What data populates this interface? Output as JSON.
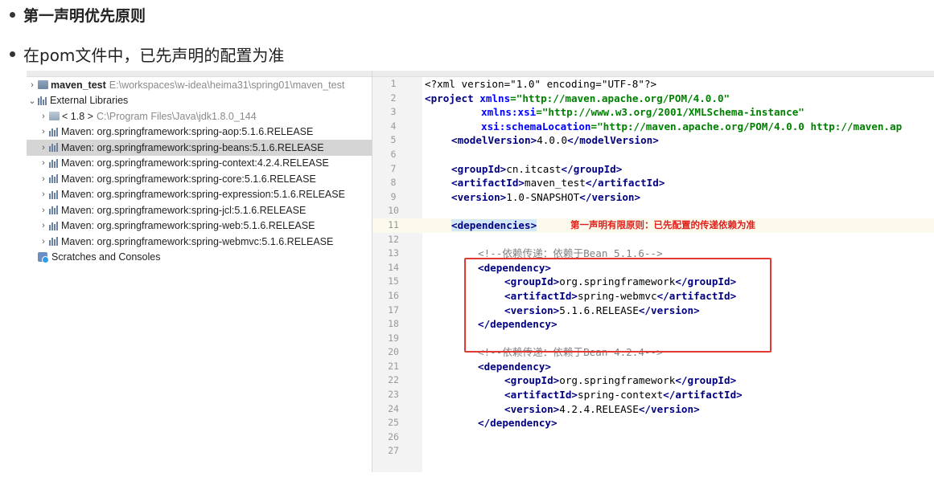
{
  "slide": {
    "bullet1": "第一声明优先原则",
    "bullet2": "在pom文件中，已先声明的配置为准"
  },
  "project_tree": {
    "root": {
      "name": "maven_test",
      "path": "E:\\workspaces\\w-idea\\heima31\\spring01\\maven_test"
    },
    "external_libraries": "External Libraries",
    "jdk": {
      "name": "< 1.8 >",
      "path": "C:\\Program Files\\Java\\jdk1.8.0_144"
    },
    "libraries": [
      "Maven: org.springframework:spring-aop:5.1.6.RELEASE",
      "Maven: org.springframework:spring-beans:5.1.6.RELEASE",
      "Maven: org.springframework:spring-context:4.2.4.RELEASE",
      "Maven: org.springframework:spring-core:5.1.6.RELEASE",
      "Maven: org.springframework:spring-expression:5.1.6.RELEASE",
      "Maven: org.springframework:spring-jcl:5.1.6.RELEASE",
      "Maven: org.springframework:spring-web:5.1.6.RELEASE",
      "Maven: org.springframework:spring-webmvc:5.1.6.RELEASE"
    ],
    "selected_library": "Maven: org.springframework:spring-beans:5.1.6.RELEASE",
    "scratches": "Scratches and Consoles"
  },
  "editor": {
    "line_numbers": [
      "1",
      "2",
      "3",
      "4",
      "5",
      "6",
      "7",
      "8",
      "9",
      "10",
      "11",
      "12",
      "13",
      "14",
      "15",
      "16",
      "17",
      "18",
      "19",
      "20",
      "21",
      "22",
      "23",
      "24",
      "25",
      "26",
      "27"
    ],
    "annotation": "第一声明有限原则：已先配置的传递依赖为准",
    "code": {
      "l1_decl": "<?xml version=\"1.0\" encoding=\"UTF-8\"?>",
      "l2_open": "<project",
      "l2_attr": " xmlns",
      "l2_val": "=\"http://maven.apache.org/POM/4.0.0\"",
      "l3_attr": "xmlns:xsi",
      "l3_val": "=\"http://www.w3.org/2001/XMLSchema-instance\"",
      "l4_attr": "xsi:schemaLocation",
      "l4_val": "=\"http://maven.apache.org/POM/4.0.0 http://maven.ap",
      "l5_tag": "modelVersion",
      "l5_val": "4.0.0",
      "l7_tag": "groupId",
      "l7_val": "cn.itcast",
      "l8_tag": "artifactId",
      "l8_val": "maven_test",
      "l9_tag": "version",
      "l9_val": "1.0-SNAPSHOT",
      "l11_tag": "dependencies",
      "l13_comment": "<!--依赖传递：依赖于Bean 5.1.6-->",
      "l14_tag": "dependency",
      "l15_val": "org.springframework",
      "l16_val": "spring-webmvc",
      "l17_val": "5.1.6.RELEASE",
      "l20_comment": "<!--依赖传递：依赖于Bean 4.2.4-->",
      "l22_val": "org.springframework",
      "l23_val": "spring-context",
      "l24_val": "4.2.4.RELEASE"
    }
  }
}
